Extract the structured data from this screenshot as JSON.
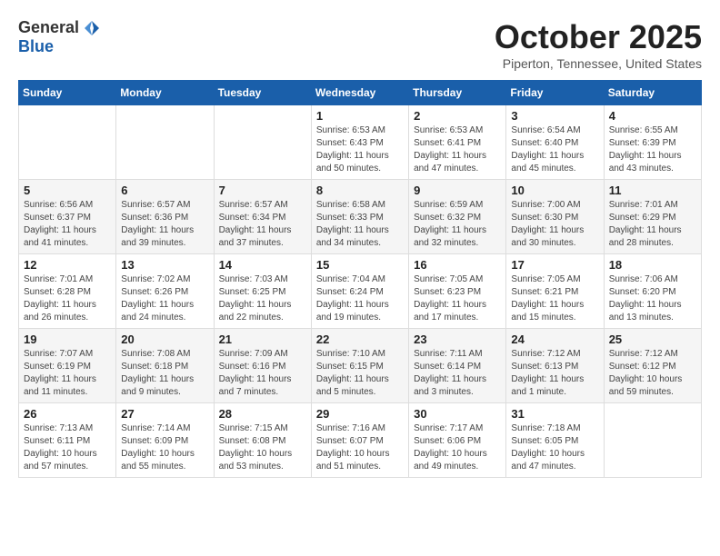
{
  "header": {
    "logo_general": "General",
    "logo_blue": "Blue",
    "month_title": "October 2025",
    "location": "Piperton, Tennessee, United States"
  },
  "weekdays": [
    "Sunday",
    "Monday",
    "Tuesday",
    "Wednesday",
    "Thursday",
    "Friday",
    "Saturday"
  ],
  "weeks": [
    [
      {
        "day": "",
        "info": ""
      },
      {
        "day": "",
        "info": ""
      },
      {
        "day": "",
        "info": ""
      },
      {
        "day": "1",
        "info": "Sunrise: 6:53 AM\nSunset: 6:43 PM\nDaylight: 11 hours\nand 50 minutes."
      },
      {
        "day": "2",
        "info": "Sunrise: 6:53 AM\nSunset: 6:41 PM\nDaylight: 11 hours\nand 47 minutes."
      },
      {
        "day": "3",
        "info": "Sunrise: 6:54 AM\nSunset: 6:40 PM\nDaylight: 11 hours\nand 45 minutes."
      },
      {
        "day": "4",
        "info": "Sunrise: 6:55 AM\nSunset: 6:39 PM\nDaylight: 11 hours\nand 43 minutes."
      }
    ],
    [
      {
        "day": "5",
        "info": "Sunrise: 6:56 AM\nSunset: 6:37 PM\nDaylight: 11 hours\nand 41 minutes."
      },
      {
        "day": "6",
        "info": "Sunrise: 6:57 AM\nSunset: 6:36 PM\nDaylight: 11 hours\nand 39 minutes."
      },
      {
        "day": "7",
        "info": "Sunrise: 6:57 AM\nSunset: 6:34 PM\nDaylight: 11 hours\nand 37 minutes."
      },
      {
        "day": "8",
        "info": "Sunrise: 6:58 AM\nSunset: 6:33 PM\nDaylight: 11 hours\nand 34 minutes."
      },
      {
        "day": "9",
        "info": "Sunrise: 6:59 AM\nSunset: 6:32 PM\nDaylight: 11 hours\nand 32 minutes."
      },
      {
        "day": "10",
        "info": "Sunrise: 7:00 AM\nSunset: 6:30 PM\nDaylight: 11 hours\nand 30 minutes."
      },
      {
        "day": "11",
        "info": "Sunrise: 7:01 AM\nSunset: 6:29 PM\nDaylight: 11 hours\nand 28 minutes."
      }
    ],
    [
      {
        "day": "12",
        "info": "Sunrise: 7:01 AM\nSunset: 6:28 PM\nDaylight: 11 hours\nand 26 minutes."
      },
      {
        "day": "13",
        "info": "Sunrise: 7:02 AM\nSunset: 6:26 PM\nDaylight: 11 hours\nand 24 minutes."
      },
      {
        "day": "14",
        "info": "Sunrise: 7:03 AM\nSunset: 6:25 PM\nDaylight: 11 hours\nand 22 minutes."
      },
      {
        "day": "15",
        "info": "Sunrise: 7:04 AM\nSunset: 6:24 PM\nDaylight: 11 hours\nand 19 minutes."
      },
      {
        "day": "16",
        "info": "Sunrise: 7:05 AM\nSunset: 6:23 PM\nDaylight: 11 hours\nand 17 minutes."
      },
      {
        "day": "17",
        "info": "Sunrise: 7:05 AM\nSunset: 6:21 PM\nDaylight: 11 hours\nand 15 minutes."
      },
      {
        "day": "18",
        "info": "Sunrise: 7:06 AM\nSunset: 6:20 PM\nDaylight: 11 hours\nand 13 minutes."
      }
    ],
    [
      {
        "day": "19",
        "info": "Sunrise: 7:07 AM\nSunset: 6:19 PM\nDaylight: 11 hours\nand 11 minutes."
      },
      {
        "day": "20",
        "info": "Sunrise: 7:08 AM\nSunset: 6:18 PM\nDaylight: 11 hours\nand 9 minutes."
      },
      {
        "day": "21",
        "info": "Sunrise: 7:09 AM\nSunset: 6:16 PM\nDaylight: 11 hours\nand 7 minutes."
      },
      {
        "day": "22",
        "info": "Sunrise: 7:10 AM\nSunset: 6:15 PM\nDaylight: 11 hours\nand 5 minutes."
      },
      {
        "day": "23",
        "info": "Sunrise: 7:11 AM\nSunset: 6:14 PM\nDaylight: 11 hours\nand 3 minutes."
      },
      {
        "day": "24",
        "info": "Sunrise: 7:12 AM\nSunset: 6:13 PM\nDaylight: 11 hours\nand 1 minute."
      },
      {
        "day": "25",
        "info": "Sunrise: 7:12 AM\nSunset: 6:12 PM\nDaylight: 10 hours\nand 59 minutes."
      }
    ],
    [
      {
        "day": "26",
        "info": "Sunrise: 7:13 AM\nSunset: 6:11 PM\nDaylight: 10 hours\nand 57 minutes."
      },
      {
        "day": "27",
        "info": "Sunrise: 7:14 AM\nSunset: 6:09 PM\nDaylight: 10 hours\nand 55 minutes."
      },
      {
        "day": "28",
        "info": "Sunrise: 7:15 AM\nSunset: 6:08 PM\nDaylight: 10 hours\nand 53 minutes."
      },
      {
        "day": "29",
        "info": "Sunrise: 7:16 AM\nSunset: 6:07 PM\nDaylight: 10 hours\nand 51 minutes."
      },
      {
        "day": "30",
        "info": "Sunrise: 7:17 AM\nSunset: 6:06 PM\nDaylight: 10 hours\nand 49 minutes."
      },
      {
        "day": "31",
        "info": "Sunrise: 7:18 AM\nSunset: 6:05 PM\nDaylight: 10 hours\nand 47 minutes."
      },
      {
        "day": "",
        "info": ""
      }
    ]
  ]
}
